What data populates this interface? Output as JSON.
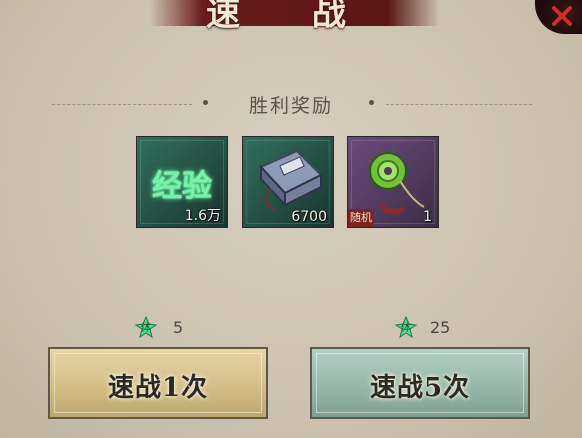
{
  "dialog": {
    "title": "速 战"
  },
  "rewards": {
    "section_title": "胜利奖励",
    "items": [
      {
        "name": "经验",
        "count": "1.6万",
        "icon": "exp-icon"
      },
      {
        "name": "",
        "count": "6700",
        "icon": "book-icon"
      },
      {
        "name": "",
        "count": "1",
        "icon": "jade-pendant-icon",
        "tag": "随机"
      }
    ]
  },
  "actions": {
    "quick1": {
      "label": "速战1次",
      "cost": "5",
      "cost_icon": "stamina-icon"
    },
    "quick5": {
      "label": "速战5次",
      "cost": "25",
      "cost_icon": "stamina-icon"
    }
  },
  "colors": {
    "banner": "#6b1d1f",
    "panel": "#cfc6b6",
    "gold_button": "#d1bf86",
    "teal_button": "#97b7aa",
    "exp_glow": "#3ef08a"
  }
}
